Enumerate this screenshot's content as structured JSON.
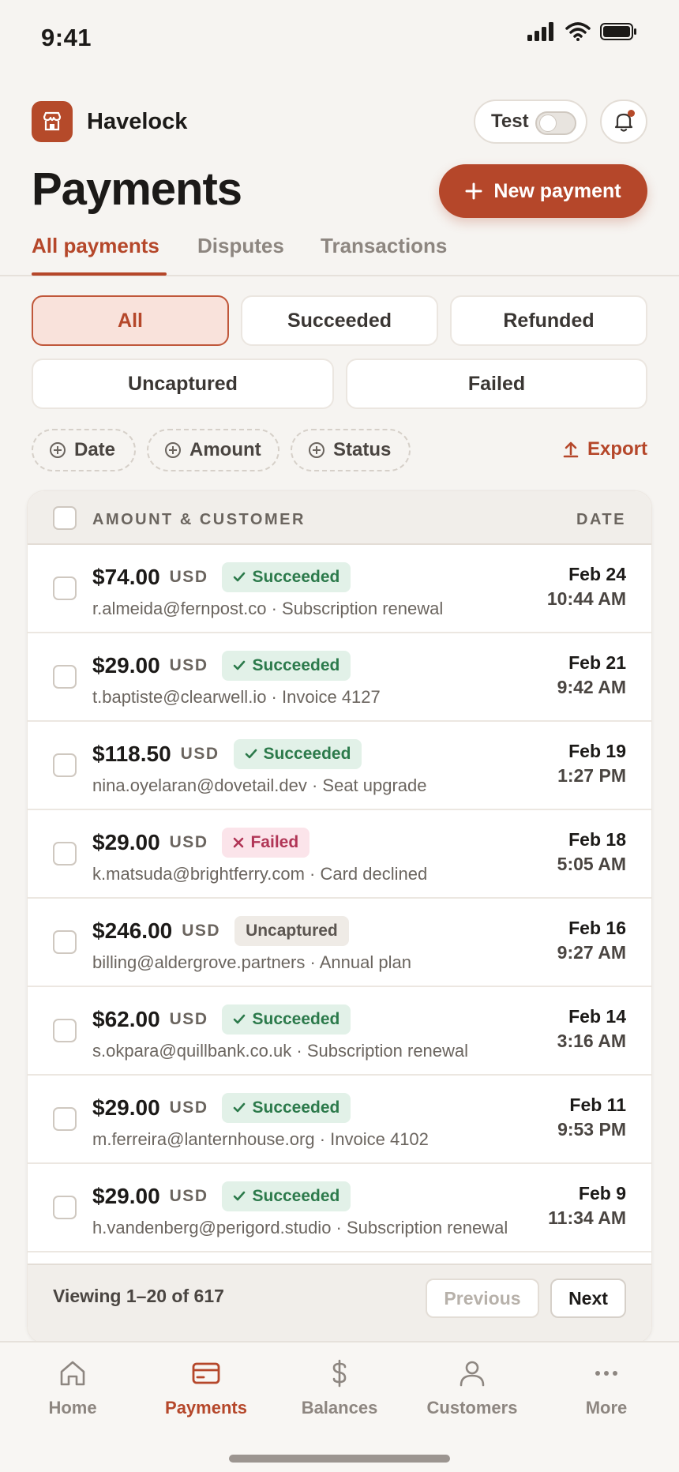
{
  "status_bar": {
    "time": "9:41"
  },
  "app": {
    "name": "Havelock",
    "test_label": "Test",
    "test_mode_on": false
  },
  "page": {
    "title": "Payments",
    "new_payment_label": "New payment"
  },
  "tabs": [
    {
      "label": "All payments",
      "active": true
    },
    {
      "label": "Disputes",
      "active": false
    },
    {
      "label": "Transactions",
      "active": false
    }
  ],
  "status_chips": [
    {
      "label": "All",
      "active": true
    },
    {
      "label": "Succeeded",
      "active": false
    },
    {
      "label": "Refunded",
      "active": false
    },
    {
      "label": "Uncaptured",
      "active": false
    },
    {
      "label": "Failed",
      "active": false
    }
  ],
  "filters": [
    {
      "label": "Date"
    },
    {
      "label": "Amount"
    },
    {
      "label": "Status"
    }
  ],
  "export_label": "Export",
  "table": {
    "col_amount": "AMOUNT & CUSTOMER",
    "col_date": "DATE",
    "rows": [
      {
        "amount": "$74.00",
        "currency": "USD",
        "status": "Succeeded",
        "status_kind": "succeeded",
        "email": "r.almeida@fernpost.co",
        "desc": "Subscription renewal",
        "date": "Feb 24",
        "time": "10:44 AM"
      },
      {
        "amount": "$29.00",
        "currency": "USD",
        "status": "Succeeded",
        "status_kind": "succeeded",
        "email": "t.baptiste@clearwell.io",
        "desc": "Invoice 4127",
        "date": "Feb 21",
        "time": "9:42 AM"
      },
      {
        "amount": "$118.50",
        "currency": "USD",
        "status": "Succeeded",
        "status_kind": "succeeded",
        "email": "nina.oyelaran@dovetail.dev",
        "desc": "Seat upgrade",
        "date": "Feb 19",
        "time": "1:27 PM"
      },
      {
        "amount": "$29.00",
        "currency": "USD",
        "status": "Failed",
        "status_kind": "failed",
        "email": "k.matsuda@brightferry.com",
        "desc": "Card declined",
        "date": "Feb 18",
        "time": "5:05 AM"
      },
      {
        "amount": "$246.00",
        "currency": "USD",
        "status": "Uncaptured",
        "status_kind": "uncaptured",
        "email": "billing@aldergrove.partners",
        "desc": "Annual plan",
        "date": "Feb 16",
        "time": "9:27 AM"
      },
      {
        "amount": "$62.00",
        "currency": "USD",
        "status": "Succeeded",
        "status_kind": "succeeded",
        "email": "s.okpara@quillbank.co.uk",
        "desc": "Subscription renewal",
        "date": "Feb 14",
        "time": "3:16 AM"
      },
      {
        "amount": "$29.00",
        "currency": "USD",
        "status": "Succeeded",
        "status_kind": "succeeded",
        "email": "m.ferreira@lanternhouse.org",
        "desc": "Invoice 4102",
        "date": "Feb 11",
        "time": "9:53 PM"
      },
      {
        "amount": "$29.00",
        "currency": "USD",
        "status": "Succeeded",
        "status_kind": "succeeded",
        "email": "h.vandenberg@perigord.studio",
        "desc": "Subscription renewal",
        "date": "Feb 9",
        "time": "11:34 AM"
      }
    ],
    "footer_text": "Viewing 1–20 of 617",
    "prev_label": "Previous",
    "next_label": "Next"
  },
  "bottom_nav": [
    {
      "label": "Home",
      "icon": "home-icon",
      "active": false
    },
    {
      "label": "Payments",
      "icon": "card-icon",
      "active": true
    },
    {
      "label": "Balances",
      "icon": "dollar-icon",
      "active": false
    },
    {
      "label": "Customers",
      "icon": "person-icon",
      "active": false
    },
    {
      "label": "More",
      "icon": "more-icon",
      "active": false
    }
  ],
  "colors": {
    "accent": "#b5472a",
    "success": "#2c7a4b",
    "danger": "#b03556",
    "background": "#f6f4f1"
  }
}
